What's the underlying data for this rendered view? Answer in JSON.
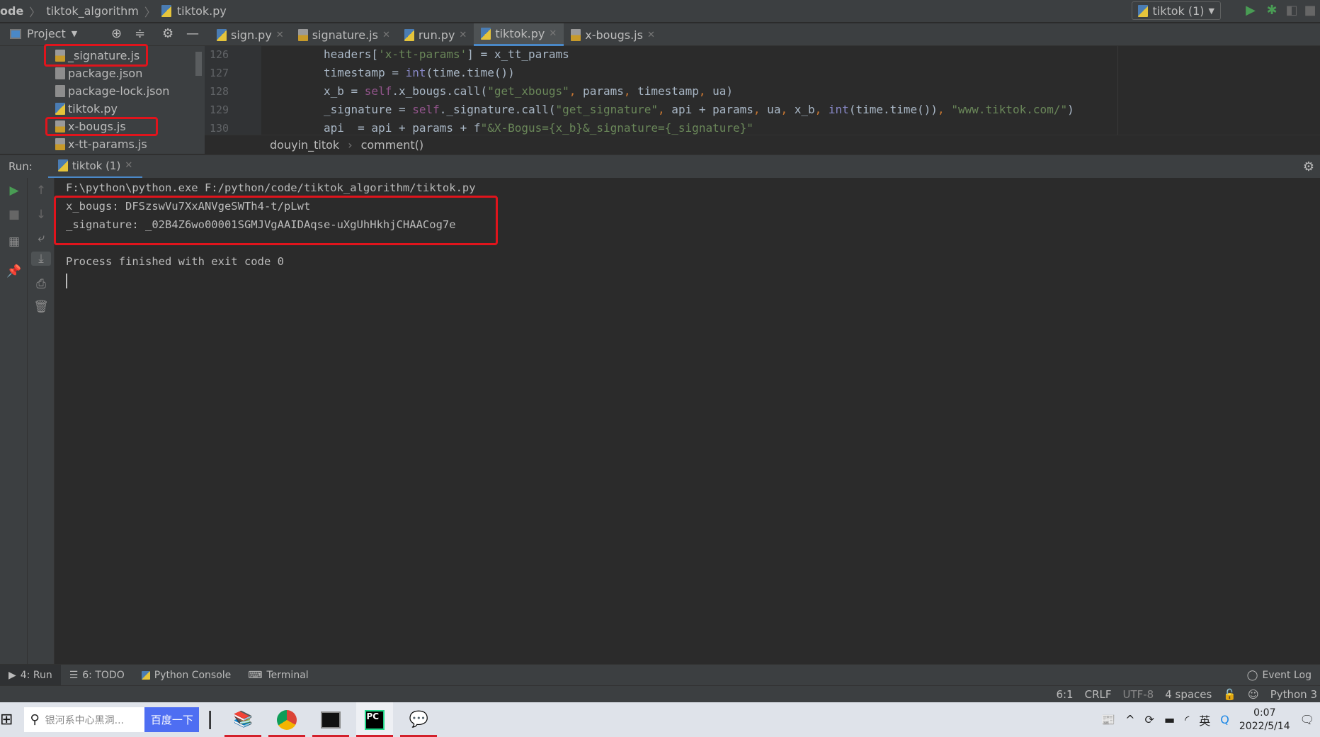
{
  "navbar": {
    "crumbs": [
      "ode",
      "tiktok_algorithm",
      "tiktok.py"
    ],
    "run_config": "tiktok (1)"
  },
  "project": {
    "title": "Project",
    "items": [
      "_signature.js",
      "package.json",
      "package-lock.json",
      "tiktok.py",
      "x-bougs.js",
      "x-tt-params.js"
    ],
    "highlighted": [
      "_signature.js",
      "x-bougs.js"
    ]
  },
  "tabs": [
    {
      "label": "sign.py",
      "active": false
    },
    {
      "label": "signature.js",
      "active": false
    },
    {
      "label": "run.py",
      "active": false
    },
    {
      "label": "tiktok.py",
      "active": true
    },
    {
      "label": "x-bougs.js",
      "active": false
    }
  ],
  "editor": {
    "line_numbers": [
      "126",
      "127",
      "128",
      "129",
      "130"
    ],
    "lines": [
      "headers['x-tt-params'] = x_tt_params",
      "timestamp = int(time.time())",
      "x_b = self.x_bougs.call(\"get_xbougs\", params, timestamp, ua)",
      "_signature = self._signature.call(\"get_signature\", api + params, ua, x_b, int(time.time()), \"www.tiktok.com/\")",
      "api  = api + params + f\"&X-Bogus={x_b}&_signature={_signature}\""
    ],
    "breadcrumb": [
      "douyin_titok",
      "comment()"
    ]
  },
  "run": {
    "label": "Run:",
    "tab": "tiktok (1)",
    "output": [
      "F:\\python\\python.exe F:/python/code/tiktok_algorithm/tiktok.py",
      "x_bougs: DFSzswVu7XxANVgeSWTh4-t/pLwt",
      "_signature: _02B4Z6wo00001SGMJVgAAIDAqse-uXgUhHkhjCHAACog7e",
      "",
      "Process finished with exit code 0"
    ]
  },
  "bottom_tools": [
    "4: Run",
    "6: TODO",
    "Python Console",
    "Terminal"
  ],
  "event_log": "Event Log",
  "status": {
    "position": "6:1",
    "line_sep": "CRLF",
    "encoding": "UTF-8",
    "indent": "4 spaces",
    "interpreter": "Python 3"
  },
  "taskbar": {
    "search_placeholder": "银河系中心黑洞...",
    "search_button": "百度一下",
    "time": "0:07",
    "date": "2022/5/14"
  },
  "colors": {
    "highlight": "#e0141c",
    "accent": "#4a88c7",
    "run_green": "#499c54"
  }
}
